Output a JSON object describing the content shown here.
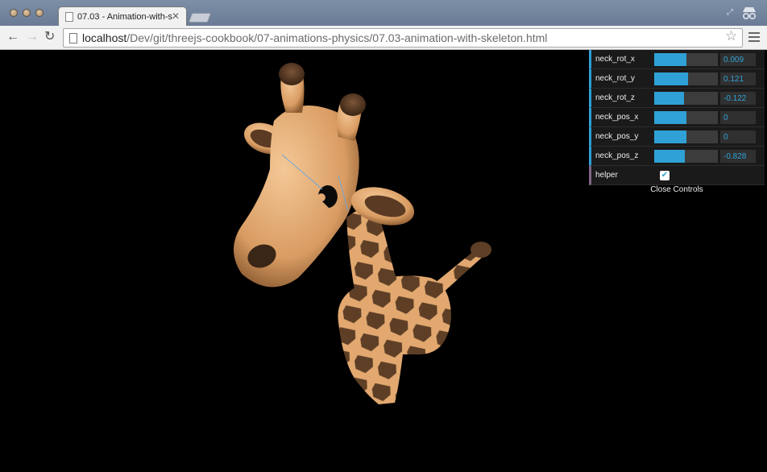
{
  "browser": {
    "tab_title": "07.03 - Animation-with-s",
    "tab_close": "✕",
    "url_host": "localhost",
    "url_path": "/Dev/git/threejs-cookbook/07-animations-physics/07.03-animation-with-skeleton.html"
  },
  "gui": {
    "controls": [
      {
        "label": "neck_rot_x",
        "value": "0.009",
        "fill": 0.5
      },
      {
        "label": "neck_rot_y",
        "value": "0.121",
        "fill": 0.53
      },
      {
        "label": "neck_rot_z",
        "value": "-0.122",
        "fill": 0.47
      },
      {
        "label": "neck_pos_x",
        "value": "0",
        "fill": 0.5
      },
      {
        "label": "neck_pos_y",
        "value": "0",
        "fill": 0.5
      },
      {
        "label": "neck_pos_z",
        "value": "-0.828",
        "fill": 0.48
      }
    ],
    "helper_label": "helper",
    "helper_checked": true,
    "close_label": "Close Controls"
  },
  "colors": {
    "accent": "#2fa1d6",
    "giraffe_skin": "#e8b07a",
    "giraffe_spots": "#5a3e27"
  }
}
